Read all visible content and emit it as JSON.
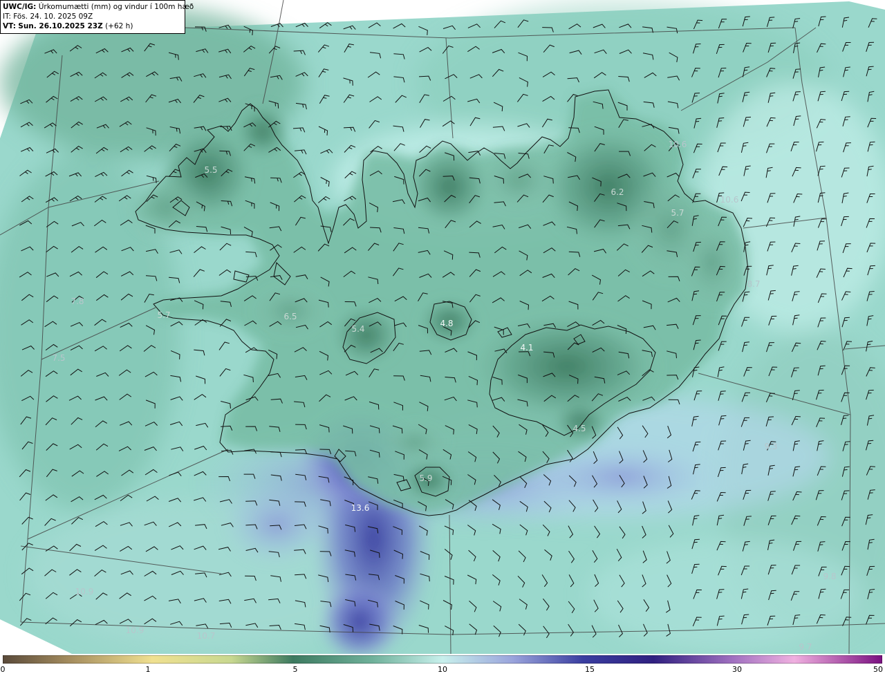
{
  "header": {
    "model": "UWC/IG:",
    "title_text": "Úrkomumætti (mm) og vindur í 100m hæð",
    "init_label": "IT:",
    "init_time": "Fös. 24. 10. 2025 09Z",
    "valid_label": "VT:",
    "valid_time": "Sun. 26.10.2025 23Z",
    "lead": "(+62 h)"
  },
  "colors": {
    "green_dark": "#3d7a60",
    "green_mid": "#6fb19a",
    "teal_light": "#b4e8e2",
    "blue_mid": "#7d86d0",
    "blue_dark": "#3a3ea0",
    "coast": "#000000",
    "grid": "#4a4a4a",
    "label": "#b9c9c4"
  },
  "colorbar": {
    "ticks": [
      "0",
      "1",
      "5",
      "10",
      "15",
      "30",
      "50"
    ]
  },
  "field_labels": [
    {
      "text": "5.5",
      "tone": "light"
    },
    {
      "text": "6.2",
      "tone": "light"
    },
    {
      "text": "5.7",
      "tone": "light"
    },
    {
      "text": "10.6",
      "tone": "faint"
    },
    {
      "text": "10.6",
      "tone": "faint"
    },
    {
      "text": "8.7",
      "tone": "faint"
    },
    {
      "text": "7.8",
      "tone": "faint"
    },
    {
      "text": "5.7",
      "tone": "light"
    },
    {
      "text": "6.5",
      "tone": "light"
    },
    {
      "text": "5.4",
      "tone": "light"
    },
    {
      "text": "4.8",
      "tone": "white"
    },
    {
      "text": "4.1",
      "tone": "white"
    },
    {
      "text": "7.5",
      "tone": "faint"
    },
    {
      "text": "4.5",
      "tone": "light"
    },
    {
      "text": "9.3",
      "tone": "faint"
    },
    {
      "text": "5.9",
      "tone": "light"
    },
    {
      "text": "13.6",
      "tone": "white"
    },
    {
      "text": "9.8",
      "tone": "faint"
    },
    {
      "text": "10.9",
      "tone": "faint"
    },
    {
      "text": "10.9",
      "tone": "faint"
    },
    {
      "text": "10.7",
      "tone": "faint"
    },
    {
      "text": "9.7",
      "tone": "faint"
    }
  ]
}
